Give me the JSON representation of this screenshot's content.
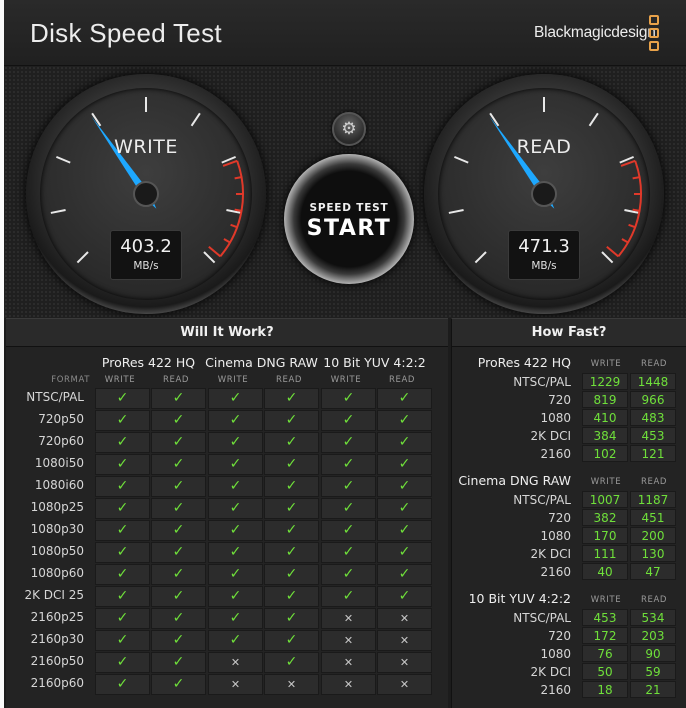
{
  "app": {
    "title": "Disk Speed Test",
    "brand": "Blackmagicdesign",
    "accent": "#e8a24a",
    "needle_color": "#1ea8ff",
    "check_color": "#6fe03a"
  },
  "gauges": {
    "write": {
      "label": "WRITE",
      "value": "403.2",
      "unit": "MB/s",
      "level": 0.37
    },
    "read": {
      "label": "READ",
      "value": "471.3",
      "unit": "MB/s",
      "level": 0.37
    }
  },
  "controls": {
    "settings_icon": "gear-icon",
    "start_line1": "SPEED TEST",
    "start_line2": "START"
  },
  "will_it_work": {
    "title": "Will It Work?",
    "format_header": "FORMAT",
    "groups": [
      "ProRes 422 HQ",
      "Cinema DNG RAW",
      "10 Bit YUV 4:2:2"
    ],
    "sub_headers": [
      "WRITE",
      "READ"
    ],
    "rows": [
      {
        "format": "NTSC/PAL",
        "cells": [
          1,
          1,
          1,
          1,
          1,
          1
        ]
      },
      {
        "format": "720p50",
        "cells": [
          1,
          1,
          1,
          1,
          1,
          1
        ]
      },
      {
        "format": "720p60",
        "cells": [
          1,
          1,
          1,
          1,
          1,
          1
        ]
      },
      {
        "format": "1080i50",
        "cells": [
          1,
          1,
          1,
          1,
          1,
          1
        ]
      },
      {
        "format": "1080i60",
        "cells": [
          1,
          1,
          1,
          1,
          1,
          1
        ]
      },
      {
        "format": "1080p25",
        "cells": [
          1,
          1,
          1,
          1,
          1,
          1
        ]
      },
      {
        "format": "1080p30",
        "cells": [
          1,
          1,
          1,
          1,
          1,
          1
        ]
      },
      {
        "format": "1080p50",
        "cells": [
          1,
          1,
          1,
          1,
          1,
          1
        ]
      },
      {
        "format": "1080p60",
        "cells": [
          1,
          1,
          1,
          1,
          1,
          1
        ]
      },
      {
        "format": "2K DCI 25",
        "cells": [
          1,
          1,
          1,
          1,
          1,
          1
        ]
      },
      {
        "format": "2160p25",
        "cells": [
          1,
          1,
          1,
          1,
          0,
          0
        ]
      },
      {
        "format": "2160p30",
        "cells": [
          1,
          1,
          1,
          1,
          0,
          0
        ]
      },
      {
        "format": "2160p50",
        "cells": [
          1,
          1,
          0,
          1,
          0,
          0
        ]
      },
      {
        "format": "2160p60",
        "cells": [
          1,
          1,
          0,
          0,
          0,
          0
        ]
      }
    ]
  },
  "how_fast": {
    "title": "How Fast?",
    "write_header": "WRITE",
    "read_header": "READ",
    "groups": [
      {
        "name": "ProRes 422 HQ",
        "rows": [
          {
            "label": "NTSC/PAL",
            "write": "1229",
            "read": "1448"
          },
          {
            "label": "720",
            "write": "819",
            "read": "966"
          },
          {
            "label": "1080",
            "write": "410",
            "read": "483"
          },
          {
            "label": "2K DCI",
            "write": "384",
            "read": "453"
          },
          {
            "label": "2160",
            "write": "102",
            "read": "121"
          }
        ]
      },
      {
        "name": "Cinema DNG RAW",
        "rows": [
          {
            "label": "NTSC/PAL",
            "write": "1007",
            "read": "1187"
          },
          {
            "label": "720",
            "write": "382",
            "read": "451"
          },
          {
            "label": "1080",
            "write": "170",
            "read": "200"
          },
          {
            "label": "2K DCI",
            "write": "111",
            "read": "130"
          },
          {
            "label": "2160",
            "write": "40",
            "read": "47"
          }
        ]
      },
      {
        "name": "10 Bit YUV 4:2:2",
        "rows": [
          {
            "label": "NTSC/PAL",
            "write": "453",
            "read": "534"
          },
          {
            "label": "720",
            "write": "172",
            "read": "203"
          },
          {
            "label": "1080",
            "write": "76",
            "read": "90"
          },
          {
            "label": "2K DCI",
            "write": "50",
            "read": "59"
          },
          {
            "label": "2160",
            "write": "18",
            "read": "21"
          }
        ]
      }
    ]
  }
}
